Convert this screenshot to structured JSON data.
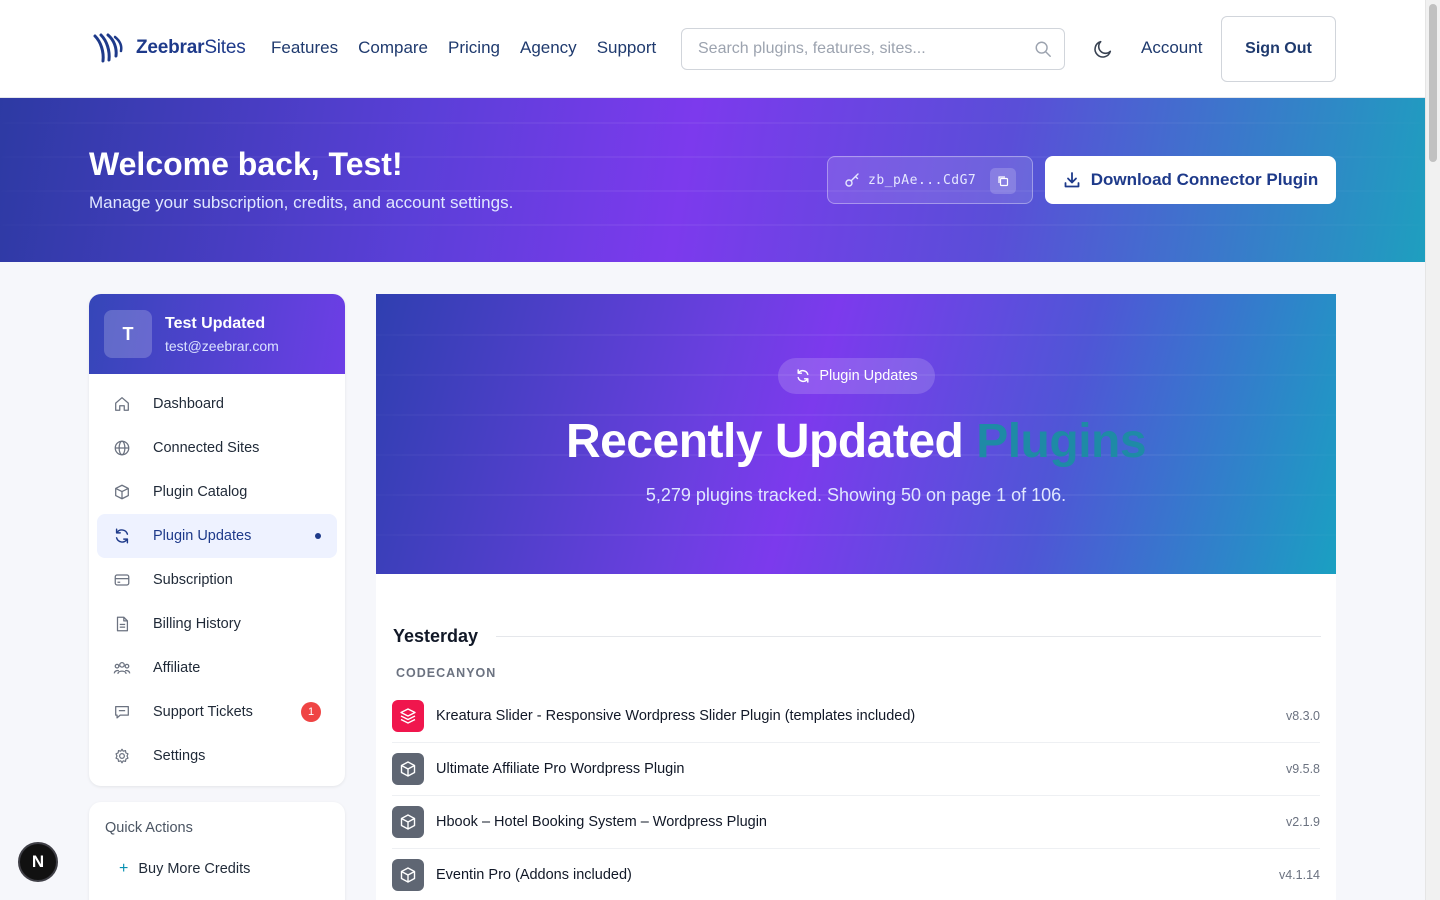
{
  "header": {
    "logo_bold": "Zeebrar",
    "logo_light": "Sites",
    "nav": [
      "Features",
      "Compare",
      "Pricing",
      "Agency",
      "Support"
    ],
    "search_placeholder": "Search plugins, features, sites...",
    "account_label": "Account",
    "signout_label": "Sign Out"
  },
  "welcome": {
    "title": "Welcome back, Test!",
    "subtitle": "Manage your subscription, credits, and account settings.",
    "api_key": "zb_pAe...CdG7",
    "download_label": "Download Connector Plugin"
  },
  "profile": {
    "initial": "T",
    "name": "Test Updated",
    "email": "test@zeebrar.com"
  },
  "sidebar": {
    "items": [
      {
        "label": "Dashboard",
        "icon": "home-icon"
      },
      {
        "label": "Connected Sites",
        "icon": "globe-icon"
      },
      {
        "label": "Plugin Catalog",
        "icon": "box-icon"
      },
      {
        "label": "Plugin Updates",
        "icon": "refresh-icon",
        "active": true
      },
      {
        "label": "Subscription",
        "icon": "credit-card-icon"
      },
      {
        "label": "Billing History",
        "icon": "file-icon"
      },
      {
        "label": "Affiliate",
        "icon": "users-icon"
      },
      {
        "label": "Support Tickets",
        "icon": "chat-icon",
        "badge": "1"
      },
      {
        "label": "Settings",
        "icon": "gear-icon"
      }
    ]
  },
  "quick_actions": {
    "title": "Quick Actions",
    "items": [
      {
        "label": "Buy More Credits"
      }
    ]
  },
  "hero": {
    "chip_label": "Plugin Updates",
    "title_main": "Recently Updated",
    "title_accent": "Plugins",
    "subtitle": "5,279 plugins tracked. Showing 50 on page 1 of 106."
  },
  "updates": {
    "section_title": "Yesterday",
    "source": "CODECANYON",
    "plugins": [
      {
        "name": "Kreatura Slider - Responsive Wordpress Slider Plugin (templates included)",
        "version": "v8.3.0",
        "icon": "layers-icon",
        "color": "#f0164d"
      },
      {
        "name": "Ultimate Affiliate Pro Wordpress Plugin",
        "version": "v9.5.8",
        "icon": "package-icon",
        "color": "#5f6673"
      },
      {
        "name": "Hbook – Hotel Booking System – Wordpress Plugin",
        "version": "v2.1.9",
        "icon": "package-icon",
        "color": "#5f6673"
      },
      {
        "name": "Eventin Pro (Addons included)",
        "version": "v4.1.14",
        "icon": "package-icon",
        "color": "#5f6673"
      }
    ]
  },
  "floating": {
    "label": "N"
  },
  "colors": {
    "brand": "#1e3a8a",
    "accent": "#7c3aed",
    "badge": "#ef4444"
  }
}
